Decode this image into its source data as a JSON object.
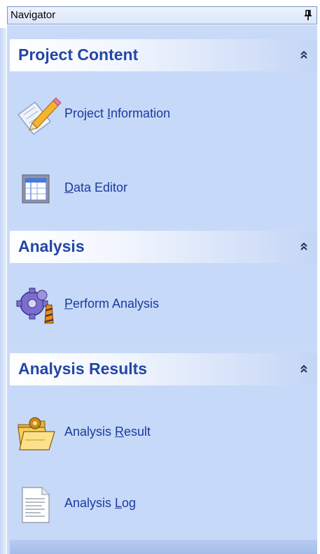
{
  "window": {
    "title": "Navigator"
  },
  "sections": [
    {
      "title": "Project Content",
      "items": [
        {
          "label_pre": "Project ",
          "label_mnemonic": "I",
          "label_post": "nformation",
          "icon": "edit-pencil-icon"
        },
        {
          "label_pre": "",
          "label_mnemonic": "D",
          "label_post": "ata Editor",
          "icon": "data-grid-icon"
        }
      ]
    },
    {
      "title": "Analysis",
      "items": [
        {
          "label_pre": "",
          "label_mnemonic": "P",
          "label_post": "erform Analysis",
          "icon": "gears-run-icon"
        }
      ]
    },
    {
      "title": "Analysis Results",
      "items": [
        {
          "label_pre": "Analysis ",
          "label_mnemonic": "R",
          "label_post": "esult",
          "icon": "folder-results-icon"
        },
        {
          "label_pre": "Analysis ",
          "label_mnemonic": "L",
          "label_post": "og",
          "icon": "document-log-icon"
        }
      ]
    }
  ],
  "colors": {
    "header_text": "#2447a6",
    "item_text": "#1a3aa0",
    "panel_bg": "#c9daf8"
  }
}
